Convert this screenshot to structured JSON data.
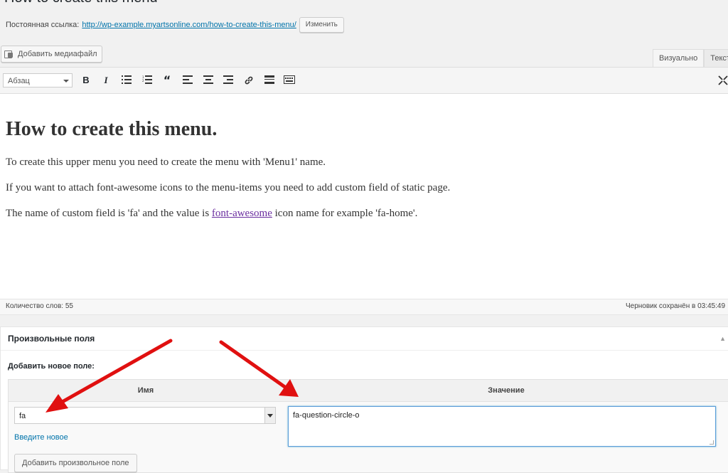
{
  "page": {
    "title": "How to create this menu"
  },
  "permalink": {
    "label": "Постоянная ссылка:",
    "url_base": "http://wp-example.myartsonline.com/",
    "url_slug": "how-to-create-this-menu/",
    "edit_label": "Изменить"
  },
  "media": {
    "add_label": "Добавить медиафайл",
    "icon": "media-icon"
  },
  "editor_tabs": [
    {
      "label": "Визуально",
      "active": true
    },
    {
      "label": "Текст",
      "active": false
    }
  ],
  "toolbar": {
    "format_value": "Абзац",
    "icons": [
      "bold-icon",
      "italic-icon",
      "bullet-list-icon",
      "numbered-list-icon",
      "blockquote-icon",
      "align-left-icon",
      "align-center-icon",
      "align-right-icon",
      "link-icon",
      "read-more-icon",
      "toolbar-toggle-icon",
      "fullscreen-icon"
    ]
  },
  "content": {
    "heading": "How to create this menu.",
    "p1": "To create this upper menu you need to create the menu with 'Menu1' name.",
    "p2": "If you want to attach font-awesome icons to the menu-items you need to add custom field of static page.",
    "p3_before": "The name of custom field is 'fa' and the value is ",
    "p3_link": "font-awesome",
    "p3_after": " icon name for example 'fa-home'."
  },
  "status": {
    "word_count": "Количество слов: 55",
    "draft_saved": "Черновик сохранён в 03:45:49"
  },
  "custom_fields": {
    "title": "Произвольные поля",
    "add_new_label": "Добавить новое поле:",
    "col_name": "Имя",
    "col_value": "Значение",
    "name_value": "fa",
    "enter_new": "Введите новое",
    "value_value": "fa-question-circle-o",
    "add_button": "Добавить произвольное поле"
  },
  "colors": {
    "link": "#0073aa",
    "visited_link": "#6b2fa0",
    "arrow": "#e01010",
    "focus": "#5b9dd9"
  }
}
